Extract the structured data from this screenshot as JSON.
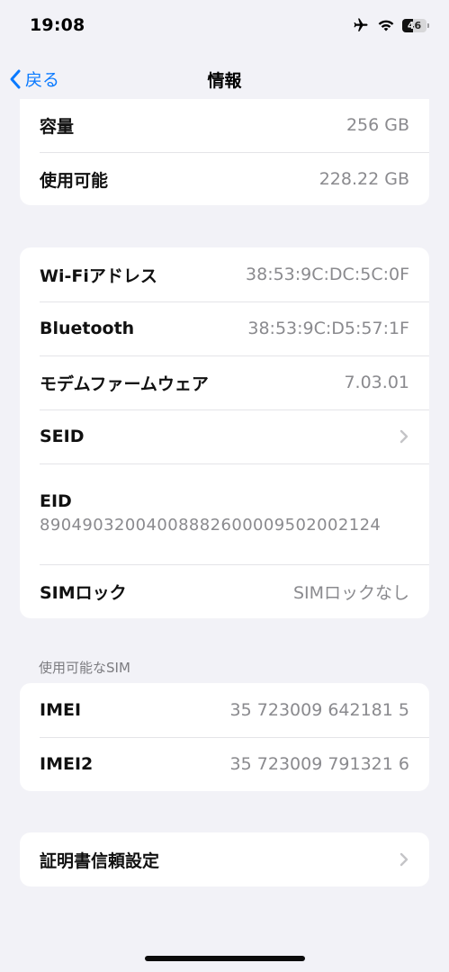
{
  "status_bar": {
    "time": "19:08",
    "battery_level": "46",
    "battery_percent": 46,
    "icons": [
      "airplane-icon",
      "wifi-icon",
      "battery-icon"
    ]
  },
  "nav": {
    "back_label": "戻る",
    "title": "情報"
  },
  "storage": {
    "capacity_label": "容量",
    "capacity_value": "256 GB",
    "available_label": "使用可能",
    "available_value": "228.22 GB"
  },
  "network": {
    "wifi_label": "Wi-Fiアドレス",
    "wifi_value": "38:53:9C:DC:5C:0F",
    "bluetooth_label": "Bluetooth",
    "bluetooth_value": "38:53:9C:D5:57:1F",
    "modem_label": "モデムファームウェア",
    "modem_value": "7.03.01",
    "seid_label": "SEID",
    "eid_label": "EID",
    "eid_value": "89049032004008882600009502002124",
    "simlock_label": "SIMロック",
    "simlock_value": "SIMロックなし"
  },
  "sim": {
    "section_header": "使用可能なSIM",
    "imei_label": "IMEI",
    "imei_value": "35 723009 642181 5",
    "imei2_label": "IMEI2",
    "imei2_value": "35 723009 791321 6"
  },
  "certificates": {
    "label": "証明書信頼設定"
  },
  "colors": {
    "accent": "#0a7aff",
    "background": "#f2f2f7",
    "secondary_text": "#8a8a8e"
  }
}
